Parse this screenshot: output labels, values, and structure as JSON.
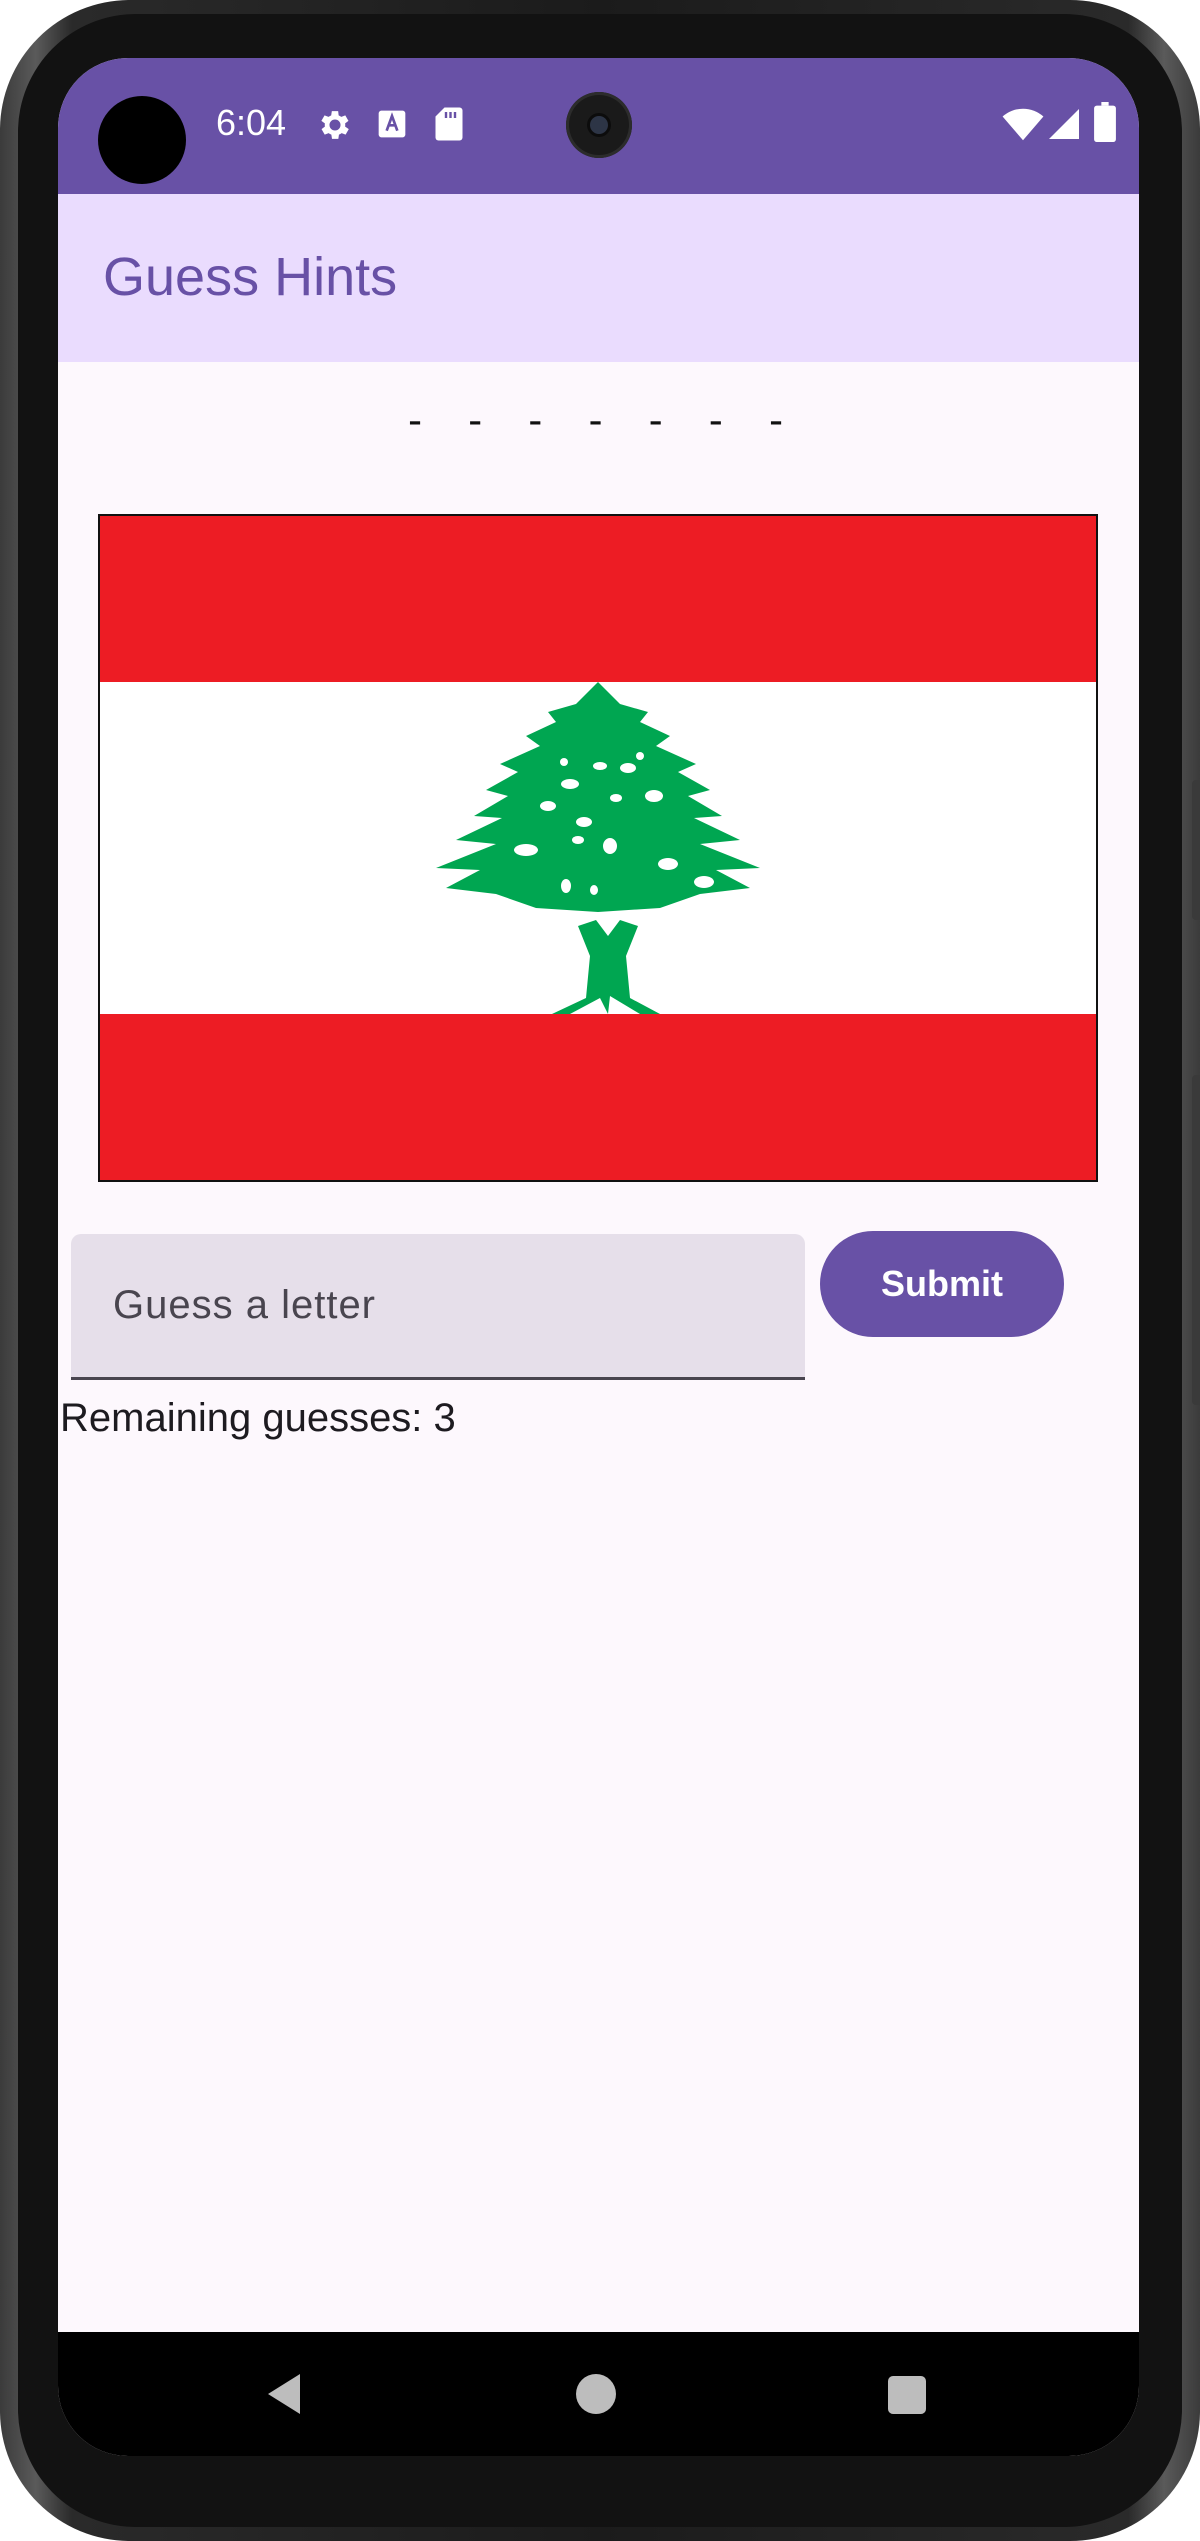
{
  "status_bar": {
    "time": "6:04",
    "background": "#6851a6",
    "icons": [
      "settings-icon",
      "text-a-icon",
      "sd-card-icon",
      "wifi-icon",
      "signal-icon",
      "battery-icon"
    ]
  },
  "app_bar": {
    "title": "Guess Hints",
    "background": "#eadcfe",
    "title_color": "#6851a6"
  },
  "game": {
    "word_blanks": "- - - - - - -",
    "flag": {
      "icon": "lebanon-flag",
      "colors": {
        "red": "#ed1c24",
        "white": "#ffffff",
        "green": "#00a651"
      }
    },
    "guess_input": {
      "value": "",
      "placeholder": "Guess a letter"
    },
    "submit_label": "Submit",
    "remaining_text": "Remaining guesses: 3"
  },
  "nav_bar": {
    "icons": [
      "back-icon",
      "home-icon",
      "recents-icon"
    ]
  }
}
